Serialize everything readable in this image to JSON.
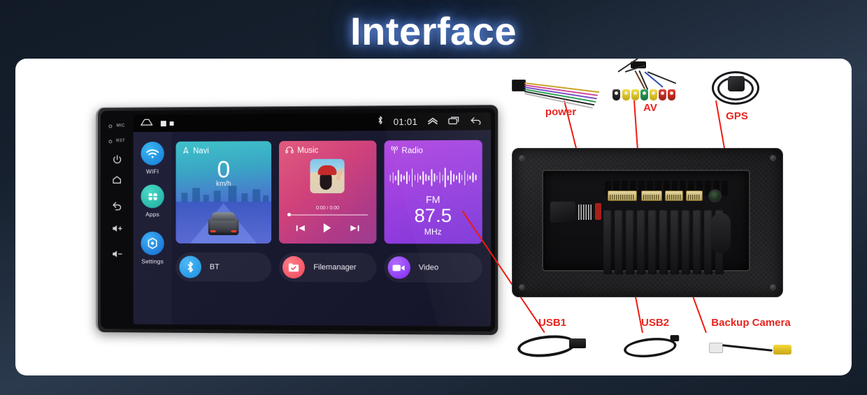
{
  "page": {
    "title": "Interface"
  },
  "left": {
    "side_labels": [
      {
        "name": "Reset"
      },
      {
        "name": "Power"
      },
      {
        "name": "Menu"
      },
      {
        "name": "Back"
      },
      {
        "name": "Vol+"
      },
      {
        "name": "Vol-"
      }
    ],
    "hardware_keys": [
      {
        "icon": "mic-icon",
        "text": "MIC"
      },
      {
        "icon": "reset-icon",
        "text": "RST"
      },
      {
        "icon": "power-icon",
        "text": ""
      },
      {
        "icon": "home-icon",
        "text": ""
      },
      {
        "icon": "back-icon",
        "text": ""
      },
      {
        "icon": "volume-up-icon",
        "text": ""
      },
      {
        "icon": "volume-down-icon",
        "text": ""
      }
    ],
    "statusbar": {
      "home_icon": "home-icon",
      "clock": "01:01",
      "bluetooth_icon": "bluetooth-icon",
      "expand_icon": "chevron-up-icon",
      "recents_icon": "recents-icon",
      "back_icon": "back-icon"
    },
    "dock": [
      {
        "label": "WIFI",
        "icon": "wifi-icon"
      },
      {
        "label": "Apps",
        "icon": "apps-icon"
      },
      {
        "label": "Settings",
        "icon": "settings-icon"
      }
    ],
    "cards": {
      "navi": {
        "title": "Navi",
        "speed": "0",
        "unit": "km/h",
        "icon": "navigation-icon"
      },
      "music": {
        "title": "Music",
        "icon": "headphones-icon",
        "time": "0:00 / 0:00",
        "prev_icon": "previous-track-icon",
        "play_icon": "play-icon",
        "next_icon": "next-track-icon"
      },
      "radio": {
        "title": "Radio",
        "icon": "radio-signal-icon",
        "band": "FM",
        "frequency": "87.5",
        "unit": "MHz"
      }
    },
    "pills": [
      {
        "label": "BT",
        "icon": "bluetooth-icon"
      },
      {
        "label": "Filemanager",
        "icon": "folder-check-icon"
      },
      {
        "label": "Video",
        "icon": "video-camera-icon"
      }
    ]
  },
  "right": {
    "accessories": [
      {
        "label": "power",
        "icon": "power-harness-icon"
      },
      {
        "label": "AV",
        "icon": "av-rca-cable-icon"
      },
      {
        "label": "GPS",
        "icon": "gps-antenna-icon"
      },
      {
        "label": "USB1",
        "icon": "usb-cable-icon"
      },
      {
        "label": "USB2",
        "icon": "usb-cable-icon"
      },
      {
        "label": "Backup Camera",
        "icon": "backup-camera-cable-icon"
      }
    ],
    "device": {
      "name": "head-unit-rear"
    }
  },
  "colors": {
    "accent_red": "#e8251f",
    "leader_blue": "#2e7fd1",
    "background_dark": "#16202e",
    "card_white": "#ffffff"
  }
}
